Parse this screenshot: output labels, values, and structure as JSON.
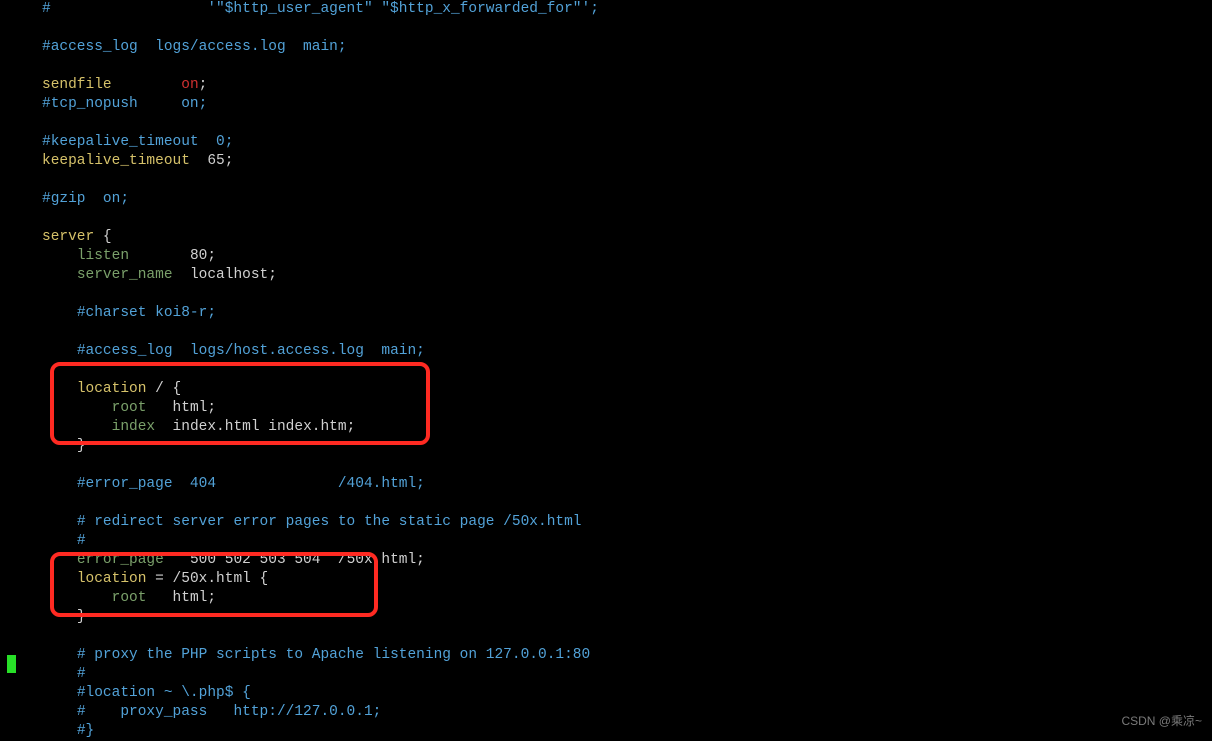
{
  "lines": [
    {
      "t": "cmt",
      "text": "#                  '\"$http_user_agent\" \"$http_x_forwarded_for\"';"
    },
    {
      "t": "blank"
    },
    {
      "t": "cmt",
      "text": "#access_log  logs/access.log  main;"
    },
    {
      "t": "blank"
    },
    {
      "segs": [
        [
          "kw",
          "sendfile"
        ],
        [
          "pad",
          "        "
        ],
        [
          "val",
          "on"
        ],
        [
          "ident",
          ";"
        ]
      ]
    },
    {
      "t": "cmt",
      "text": "#tcp_nopush     on;"
    },
    {
      "t": "blank"
    },
    {
      "t": "cmt",
      "text": "#keepalive_timeout  0;"
    },
    {
      "segs": [
        [
          "kw",
          "keepalive_timeout"
        ],
        [
          "pad",
          "  "
        ],
        [
          "ident",
          "65;"
        ]
      ]
    },
    {
      "t": "blank"
    },
    {
      "t": "cmt",
      "text": "#gzip  on;"
    },
    {
      "t": "blank"
    },
    {
      "segs": [
        [
          "kw",
          "server"
        ],
        [
          "ident",
          " {"
        ]
      ]
    },
    {
      "segs": [
        [
          "pad",
          "    "
        ],
        [
          "kw2",
          "listen"
        ],
        [
          "pad",
          "       "
        ],
        [
          "ident",
          "80;"
        ]
      ]
    },
    {
      "segs": [
        [
          "pad",
          "    "
        ],
        [
          "kw2",
          "server_name"
        ],
        [
          "pad",
          "  "
        ],
        [
          "ident",
          "localhost;"
        ]
      ]
    },
    {
      "t": "blank"
    },
    {
      "t": "cmt4",
      "text": "#charset koi8-r;"
    },
    {
      "t": "blank"
    },
    {
      "t": "cmt4",
      "text": "#access_log  logs/host.access.log  main;"
    },
    {
      "t": "blank"
    },
    {
      "segs": [
        [
          "pad",
          "    "
        ],
        [
          "kw",
          "location"
        ],
        [
          "ident",
          " / {"
        ]
      ]
    },
    {
      "segs": [
        [
          "pad",
          "        "
        ],
        [
          "kw2",
          "root"
        ],
        [
          "pad",
          "   "
        ],
        [
          "ident",
          "html;"
        ]
      ]
    },
    {
      "segs": [
        [
          "pad",
          "        "
        ],
        [
          "kw2",
          "index"
        ],
        [
          "pad",
          "  "
        ],
        [
          "ident",
          "index.html index.htm;"
        ]
      ]
    },
    {
      "segs": [
        [
          "pad",
          "    "
        ],
        [
          "ident",
          "}"
        ]
      ]
    },
    {
      "t": "blank"
    },
    {
      "t": "cmt4",
      "text": "#error_page  404              /404.html;"
    },
    {
      "t": "blank"
    },
    {
      "t": "cmt4",
      "text": "# redirect server error pages to the static page /50x.html"
    },
    {
      "t": "cmt4",
      "text": "#"
    },
    {
      "segs": [
        [
          "pad",
          "    "
        ],
        [
          "kw2",
          "error_page"
        ],
        [
          "pad",
          "   "
        ],
        [
          "ident",
          "500 502 503 504  /50x.html;"
        ]
      ]
    },
    {
      "segs": [
        [
          "pad",
          "    "
        ],
        [
          "kw",
          "location"
        ],
        [
          "ident",
          " = /50x.html {"
        ]
      ]
    },
    {
      "segs": [
        [
          "pad",
          "        "
        ],
        [
          "kw2",
          "root"
        ],
        [
          "pad",
          "   "
        ],
        [
          "ident",
          "html;"
        ]
      ]
    },
    {
      "segs": [
        [
          "pad",
          "    "
        ],
        [
          "ident",
          "}"
        ]
      ]
    },
    {
      "t": "blank"
    },
    {
      "t": "cmt4",
      "text": "# proxy the PHP scripts to Apache listening on 127.0.0.1:80"
    },
    {
      "t": "cmt4",
      "text": "#"
    },
    {
      "t": "cmt4",
      "text": "#location ~ \\.php$ {"
    },
    {
      "t": "cmt4",
      "text": "#    proxy_pass   http://127.0.0.1;"
    },
    {
      "t": "cmt4",
      "text": "#}"
    }
  ],
  "watermark": "CSDN @乘凉~"
}
